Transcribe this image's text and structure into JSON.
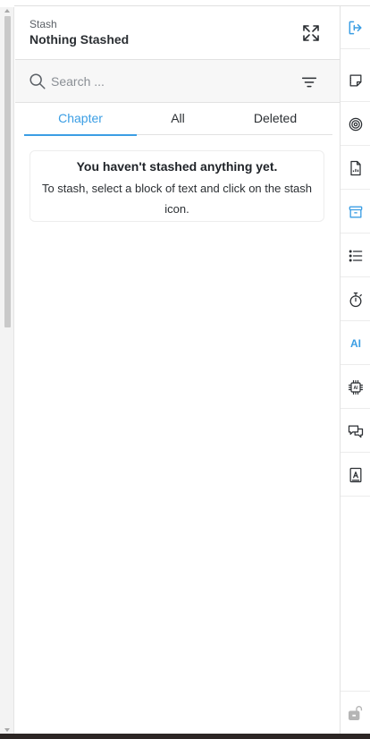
{
  "header": {
    "kicker": "Stash",
    "title": "Nothing Stashed"
  },
  "search": {
    "placeholder": "Search ..."
  },
  "tabs": [
    {
      "label": "Chapter",
      "active": true
    },
    {
      "label": "All",
      "active": false
    },
    {
      "label": "Deleted",
      "active": false
    }
  ],
  "empty_state": {
    "heading": "You haven't stashed anything yet.",
    "message": "To stash, select a block of text and click on the stash icon."
  },
  "rail": {
    "ai_label": "AI",
    "icons": [
      "exit-icon",
      "note-icon",
      "target-icon",
      "report-icon",
      "stash-box-icon",
      "list-icon",
      "stopwatch-icon",
      "ai-label",
      "ai-chip-icon",
      "chat-icon",
      "contact-book-icon",
      "lock-icon"
    ]
  },
  "colors": {
    "accent": "#3b9ee4",
    "text": "#1f2328",
    "border": "#e2e2e2"
  }
}
